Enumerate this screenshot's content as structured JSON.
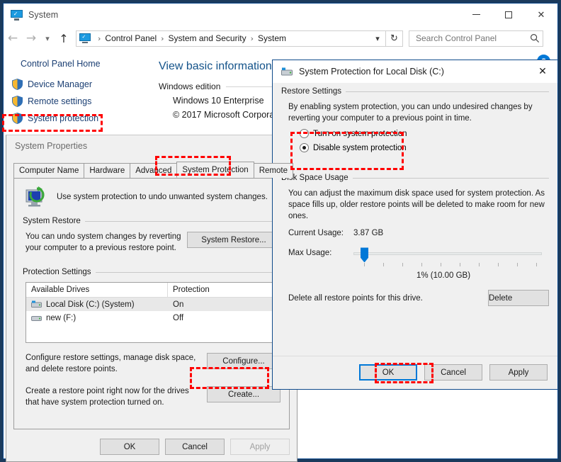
{
  "window": {
    "title": "System",
    "title_icon": "system-monitor-icon",
    "controls": {
      "minimize": "minimize-icon",
      "maximize": "maximize-icon",
      "close": "close-icon"
    }
  },
  "navbar": {
    "back": "back-arrow-icon",
    "forward": "forward-arrow-icon",
    "recent": "chevron-down-icon",
    "up": "up-arrow-icon",
    "breadcrumbs": [
      "Control Panel",
      "System and Security",
      "System"
    ],
    "separator": "›",
    "dropdown": "chevron-down-icon",
    "refresh": "refresh-icon",
    "search": {
      "placeholder": "Search Control Panel",
      "value": "",
      "icon": "search-icon"
    }
  },
  "sidebar": {
    "home": "Control Panel Home",
    "items": [
      {
        "label": "Device Manager",
        "icon": "shield-icon"
      },
      {
        "label": "Remote settings",
        "icon": "shield-icon"
      },
      {
        "label": "System protection",
        "icon": "shield-icon",
        "annotated": true
      }
    ]
  },
  "main": {
    "heading": "View basic information",
    "help_icon": "help-icon",
    "help_glyph": "?",
    "section_label": "Windows edition",
    "edition": "Windows 10 Enterprise",
    "copyright": "© 2017 Microsoft Corpora"
  },
  "system_properties": {
    "title": "System Properties",
    "tabs": [
      {
        "label": "Computer Name",
        "active": false
      },
      {
        "label": "Hardware",
        "active": false
      },
      {
        "label": "Advanced",
        "active": false
      },
      {
        "label": "System Protection",
        "active": true,
        "annotated": true
      },
      {
        "label": "Remote",
        "active": false
      }
    ],
    "intro_text": "Use system protection to undo unwanted system changes.",
    "intro_icon": "system-restore-icon",
    "system_restore": {
      "legend": "System Restore",
      "description": "You can undo system changes by reverting your computer to a previous restore point.",
      "button": "System Restore..."
    },
    "protection_settings": {
      "legend": "Protection Settings",
      "columns": [
        "Available Drives",
        "Protection"
      ],
      "rows": [
        {
          "drive": "Local Disk (C:) (System)",
          "protection": "On",
          "selected": true,
          "icon": "system-drive-icon"
        },
        {
          "drive": "new (F:)",
          "protection": "Off",
          "selected": false,
          "icon": "drive-icon"
        }
      ],
      "configure_description": "Configure restore settings, manage disk space, and delete restore points.",
      "configure_button": "Configure...",
      "create_description": "Create a restore point right now for the drives that have system protection turned on.",
      "create_button": "Create..."
    },
    "footer": [
      {
        "label": "OK",
        "disabled": false
      },
      {
        "label": "Cancel",
        "disabled": false
      },
      {
        "label": "Apply",
        "disabled": true
      }
    ]
  },
  "protection_dialog": {
    "title": "System Protection for Local Disk (C:)",
    "title_icon": "system-drive-icon",
    "close_icon": "close-icon",
    "restore_settings": {
      "legend": "Restore Settings",
      "description": "By enabling system protection, you can undo undesired changes by reverting your computer to a previous point in time.",
      "options": [
        {
          "label": "Turn on system protection",
          "selected": false
        },
        {
          "label": "Disable system protection",
          "selected": true
        }
      ]
    },
    "disk_space": {
      "legend": "Disk Space Usage",
      "description": "You can adjust the maximum disk space used for system protection. As space fills up, older restore points will be deleted to make room for new ones.",
      "current_usage_label": "Current Usage:",
      "current_usage_value": "3.87 GB",
      "max_usage_label": "Max Usage:",
      "slider_percent": 1,
      "slider_value_label": "1% (10.00 GB)",
      "delete_description": "Delete all restore points for this drive.",
      "delete_button": "Delete"
    },
    "footer": [
      {
        "label": "OK",
        "focused": true,
        "annotated": true
      },
      {
        "label": "Cancel",
        "focused": false
      },
      {
        "label": "Apply",
        "focused": false
      }
    ]
  },
  "annotations": {
    "color": "#ff0000",
    "style": "dashed"
  }
}
